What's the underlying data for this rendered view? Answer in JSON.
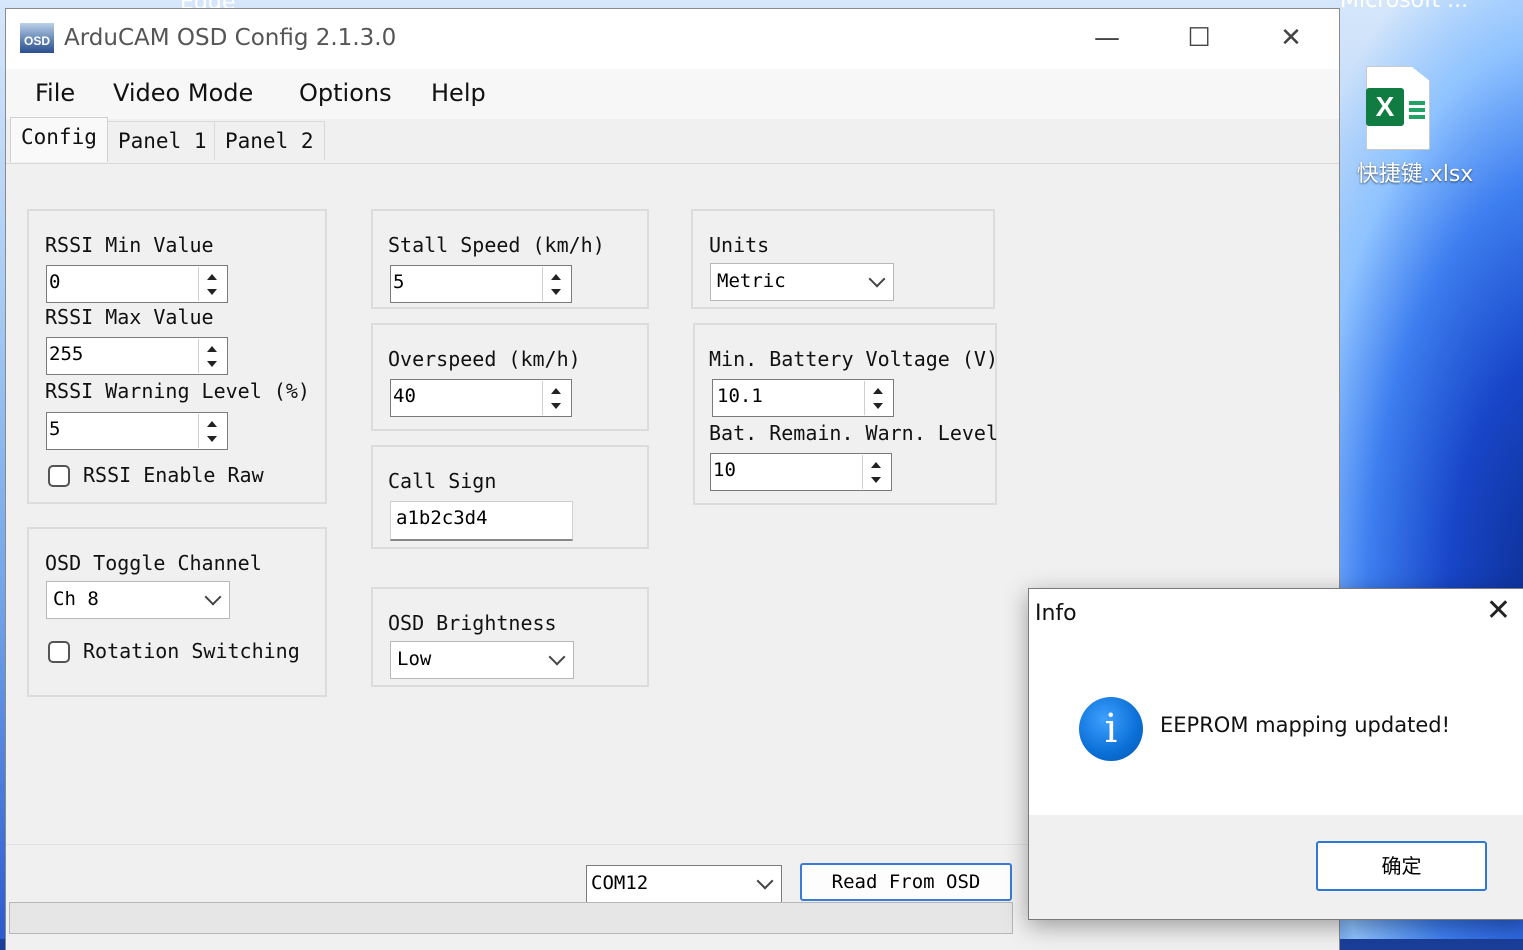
{
  "desktop": {
    "topleft_label": "Edge",
    "topright_label": "Microsoft ...",
    "file_icon_label": "快捷键.xlsx"
  },
  "window": {
    "title": "ArduCAM OSD Config 2.1.3.0",
    "app_icon_text": "OSD",
    "minimize": "—",
    "maximize": "☐",
    "close": "✕"
  },
  "menu": [
    "File",
    "Video Mode",
    "Options",
    "Help"
  ],
  "tabs": [
    "Config",
    "Panel 1",
    "Panel 2"
  ],
  "rssi": {
    "min_label": "RSSI Min Value",
    "min_value": "0",
    "max_label": "RSSI Max Value",
    "max_value": "255",
    "warn_label": "RSSI Warning Level (%)",
    "warn_value": "5",
    "enable_raw_label": "RSSI Enable Raw"
  },
  "osd_toggle": {
    "label": "OSD Toggle Channel",
    "value": "Ch 8",
    "rotation_label": "Rotation Switching"
  },
  "stall": {
    "label": "Stall Speed (km/h)",
    "value": "5"
  },
  "overspeed": {
    "label": "Overspeed (km/h)",
    "value": "40"
  },
  "callsign": {
    "label": "Call Sign",
    "value": "a1b2c3d4"
  },
  "brightness": {
    "label": "OSD Brightness",
    "value": "Low"
  },
  "units": {
    "label": "Units",
    "value": "Metric"
  },
  "battery": {
    "min_label": "Min. Battery Voltage (V)",
    "min_value": "10.1",
    "remain_label": "Bat. Remain. Warn. Level",
    "remain_value": "10"
  },
  "bottom": {
    "port": "COM12",
    "read_button": "Read From OSD"
  },
  "dialog": {
    "title": "Info",
    "close": "✕",
    "icon": "i",
    "message": "EEPROM mapping updated!",
    "ok_label": "确定"
  }
}
